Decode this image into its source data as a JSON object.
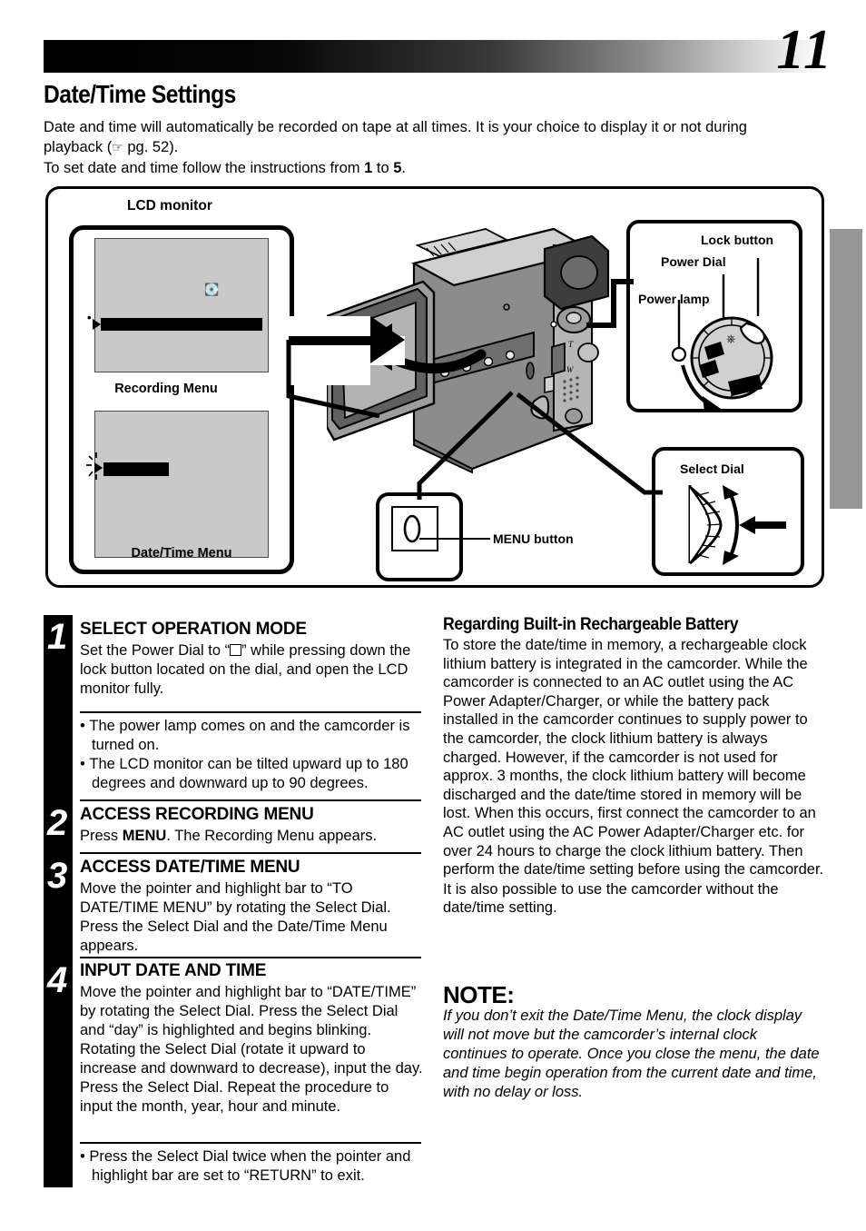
{
  "page": {
    "number": "11",
    "title": "Date/Time Settings",
    "intro_line1": "Date and time will automatically be recorded on tape at all times. It is your choice to display it or not during",
    "intro_line2_pre": "playback (",
    "intro_hand_icon": "pointing-hand-icon",
    "intro_line2_ref": " pg. 52).",
    "intro_line3_pre": "To set date and time follow the instructions from ",
    "intro_step_from": "1",
    "intro_line3_mid": " to ",
    "intro_step_to": "5",
    "intro_line3_end": "."
  },
  "figure": {
    "lcd_monitor_label": "LCD monitor",
    "screen_top_caption": "Recording Menu",
    "screen_bottom_caption": "Date/Time Menu",
    "screen_icon": "tape-cassette-icon",
    "callouts": {
      "lock_button": "Lock button",
      "power_dial": "Power Dial",
      "power_lamp": "Power lamp",
      "select_dial": "Select Dial",
      "menu_button": "MENU button"
    }
  },
  "steps": [
    {
      "number": "1",
      "title": "SELECT OPERATION MODE",
      "body_pre": "Set the Power Dial to “",
      "body_symbol": "white-square-icon",
      "body_post": "” while pressing down the lock button located on the dial, and open the LCD monitor fully.",
      "bullets": [
        "The power lamp comes on and the camcorder is turned on.",
        "The LCD monitor can be tilted upward up to 180 degrees and downward up to 90 degrees."
      ]
    },
    {
      "number": "2",
      "title": "ACCESS RECORDING MENU",
      "body_pre": "Press ",
      "body_bold": "MENU",
      "body_post": ". The Recording Menu appears.",
      "bullets": []
    },
    {
      "number": "3",
      "title": "ACCESS DATE/TIME MENU",
      "body_post": "Move the pointer and highlight bar to “TO DATE/TIME MENU” by rotating the Select Dial. Press the Select Dial and the Date/Time Menu appears.",
      "bullets": []
    },
    {
      "number": "4",
      "title": "INPUT DATE AND TIME",
      "body_post": "Move the pointer and highlight bar to “DATE/TIME” by rotating the Select Dial. Press the Select Dial and “day” is highlighted and begins blinking.\nRotating the Select Dial (rotate it upward to increase and downward to decrease), input the day. Press the Select Dial. Repeat the procedure to input the month, year, hour and minute.",
      "bullets": [
        "Press the Select Dial twice when the pointer and highlight bar are set to “RETURN” to exit."
      ]
    }
  ],
  "right_column": {
    "heading": "Regarding Built-in Rechargeable Battery",
    "paragraph1": "To store the date/time in memory, a rechargeable clock lithium battery is integrated in the camcorder. While the camcorder is connected to an AC outlet using the AC Power Adapter/Charger, or while the battery pack installed in the camcorder continues to supply power to the camcorder, the clock lithium battery is always charged. However, if the camcorder is not used for approx. 3 months, the clock lithium battery will become discharged and the date/time stored in memory will be lost. When this occurs, first connect the camcorder to an AC outlet using the AC Power Adapter/Charger etc. for over 24 hours to charge the clock lithium battery. Then perform the date/time setting before using the camcorder.",
    "paragraph2": "It is also possible to use the camcorder without the date/time setting.",
    "note_heading": "NOTE:",
    "note_body": "If you don’t exit the Date/Time Menu, the clock display will not move but the camcorder’s internal clock continues to operate. Once you close the menu, the date and time begin operation from the current date and time, with no delay or loss."
  },
  "colors": {
    "screen_bg": "#c9c9c9",
    "tab": "#979797",
    "ink": "#000000"
  }
}
